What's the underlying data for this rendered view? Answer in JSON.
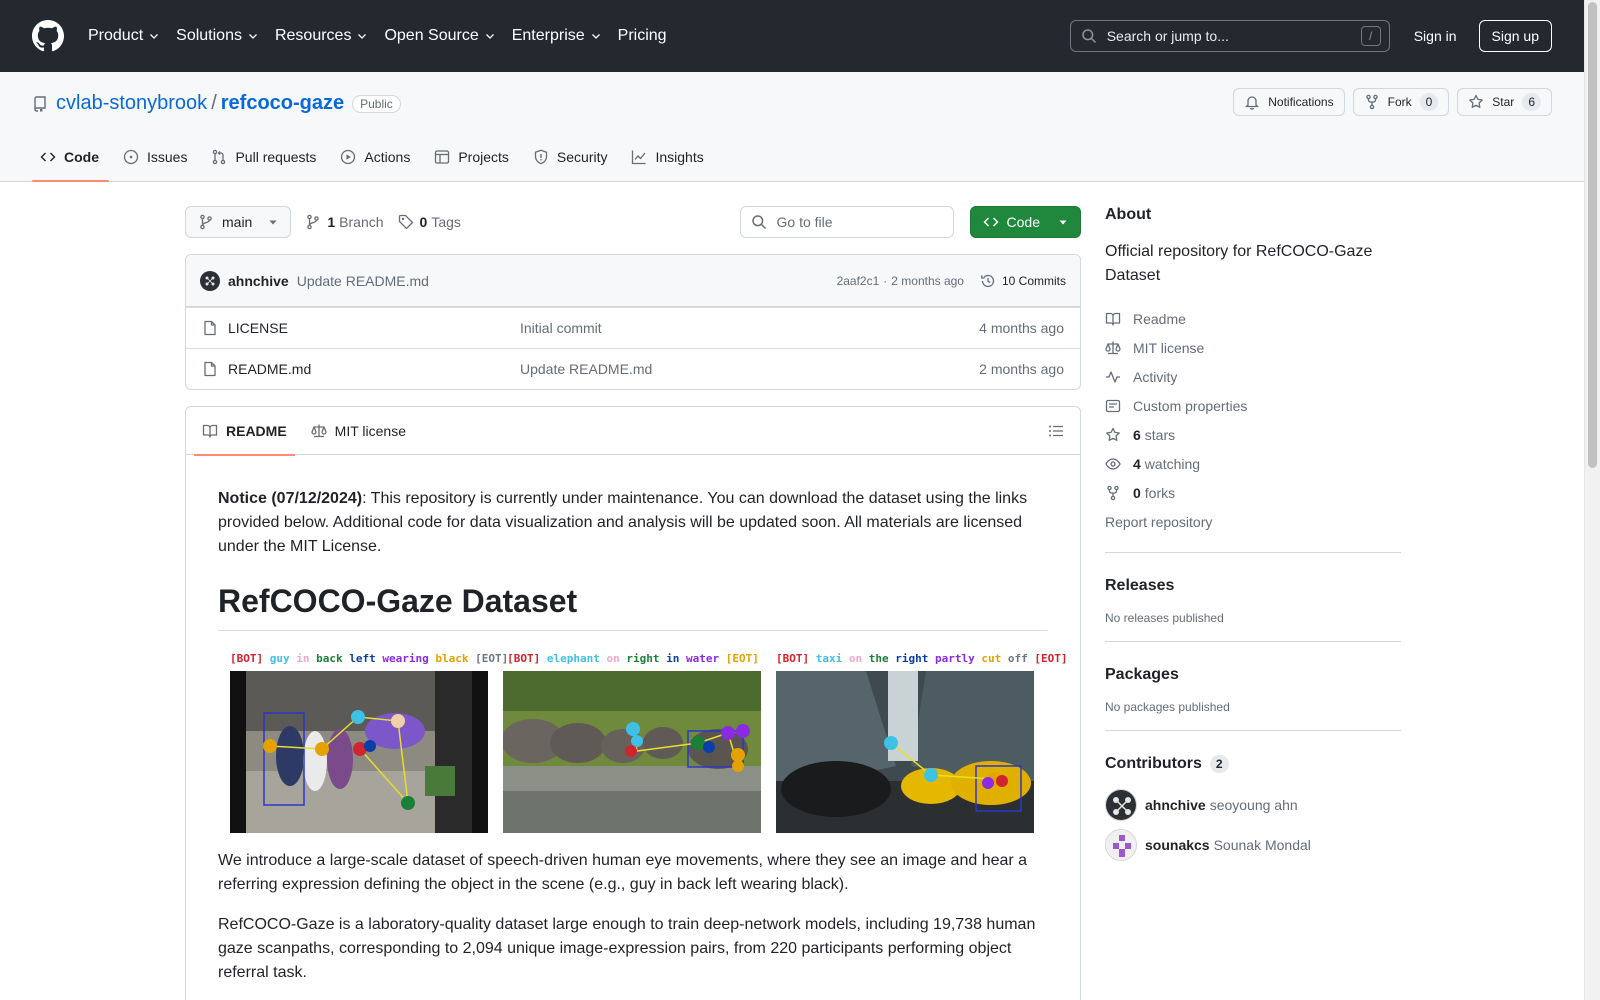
{
  "header": {
    "nav": [
      "Product",
      "Solutions",
      "Resources",
      "Open Source",
      "Enterprise",
      "Pricing"
    ],
    "search_placeholder": "Search or jump to...",
    "search_key": "/",
    "sign_in": "Sign in",
    "sign_up": "Sign up"
  },
  "repo": {
    "owner": "cvlab-stonybrook",
    "separator": "/",
    "name": "refcoco-gaze",
    "visibility": "Public",
    "notifications": "Notifications",
    "fork_label": "Fork",
    "fork_count": "0",
    "star_label": "Star",
    "star_count": "6"
  },
  "tabs": [
    "Code",
    "Issues",
    "Pull requests",
    "Actions",
    "Projects",
    "Security",
    "Insights"
  ],
  "file_nav": {
    "branch": "main",
    "branch_count": "1",
    "branch_label": "Branch",
    "tag_count": "0",
    "tag_label": "Tags",
    "go_to_file": "Go to file",
    "code_button": "Code"
  },
  "latest_commit": {
    "author": "ahnchive",
    "message": "Update README.md",
    "sha": "2aaf2c1",
    "dot": "·",
    "time": "2 months ago",
    "commits": "10 Commits"
  },
  "files": [
    {
      "name": "LICENSE",
      "message": "Initial commit",
      "time": "4 months ago"
    },
    {
      "name": "README.md",
      "message": "Update README.md",
      "time": "2 months ago"
    }
  ],
  "readme": {
    "tab_readme": "README",
    "tab_license": "MIT license",
    "notice_bold": "Notice (07/12/2024)",
    "notice_text": ": This repository is currently under maintenance. You can download the dataset using the links provided below. Additional code for data visualization and analysis will be updated soon. All materials are licensed under the MIT License.",
    "title": "RefCOCO-Gaze Dataset",
    "captions": [
      [
        {
          "w": "[BOT]",
          "c": "#d1242f"
        },
        {
          "w": "guy",
          "c": "#3fc1e6"
        },
        {
          "w": "in",
          "c": "#f0a8c8"
        },
        {
          "w": "back",
          "c": "#1a7f37"
        },
        {
          "w": "left",
          "c": "#0a3ea8"
        },
        {
          "w": "wearing",
          "c": "#8a2be2"
        },
        {
          "w": "black",
          "c": "#e5a100"
        },
        {
          "w": "[EOT]",
          "c": "#6e7781"
        }
      ],
      [
        {
          "w": "[BOT]",
          "c": "#d1242f"
        },
        {
          "w": "elephant",
          "c": "#3fc1e6"
        },
        {
          "w": "on",
          "c": "#f0a8c8"
        },
        {
          "w": "right",
          "c": "#1a7f37"
        },
        {
          "w": "in",
          "c": "#0a3ea8"
        },
        {
          "w": "water",
          "c": "#8a2be2"
        },
        {
          "w": "[EOT]",
          "c": "#e5a100"
        }
      ],
      [
        {
          "w": "[BOT]",
          "c": "#d1242f"
        },
        {
          "w": "taxi",
          "c": "#3fc1e6"
        },
        {
          "w": "on",
          "c": "#f0a8c8"
        },
        {
          "w": "the",
          "c": "#1a7f37"
        },
        {
          "w": "right",
          "c": "#0a3ea8"
        },
        {
          "w": "partly",
          "c": "#8a2be2"
        },
        {
          "w": "cut",
          "c": "#e5a100"
        },
        {
          "w": "off",
          "c": "#6e7781"
        },
        {
          "w": "[EOT]",
          "c": "#d1242f"
        }
      ]
    ],
    "intro": "We introduce a large-scale dataset of speech-driven human eye movements, where they see an image and hear a referring expression defining the object in the scene (e.g., guy in back left wearing black).",
    "details": "RefCOCO-Gaze is a laboratory-quality dataset large enough to train deep-network models, including 19,738 human gaze scanpaths, corresponding to 2,094 unique image-expression pairs, from 220 participants performing object referral task."
  },
  "sidebar": {
    "about_title": "About",
    "description": "Official repository for RefCOCO-Gaze Dataset",
    "readme": "Readme",
    "license": "MIT license",
    "activity": "Activity",
    "custom_properties": "Custom properties",
    "stars_count": "6",
    "stars_label": "stars",
    "watching_count": "4",
    "watching_label": "watching",
    "forks_count": "0",
    "forks_label": "forks",
    "report": "Report repository",
    "releases_title": "Releases",
    "releases_empty": "No releases published",
    "packages_title": "Packages",
    "packages_empty": "No packages published",
    "contributors_title": "Contributors",
    "contributors_count": "2",
    "contributors": [
      {
        "login": "ahnchive",
        "name": "seoyoung ahn"
      },
      {
        "login": "sounakcs",
        "name": "Sounak Mondal"
      }
    ]
  },
  "colors": {
    "header_bg": "#24292f",
    "link": "#0969da",
    "primary_button": "#1f883d",
    "tab_underline": "#fd8c73"
  }
}
